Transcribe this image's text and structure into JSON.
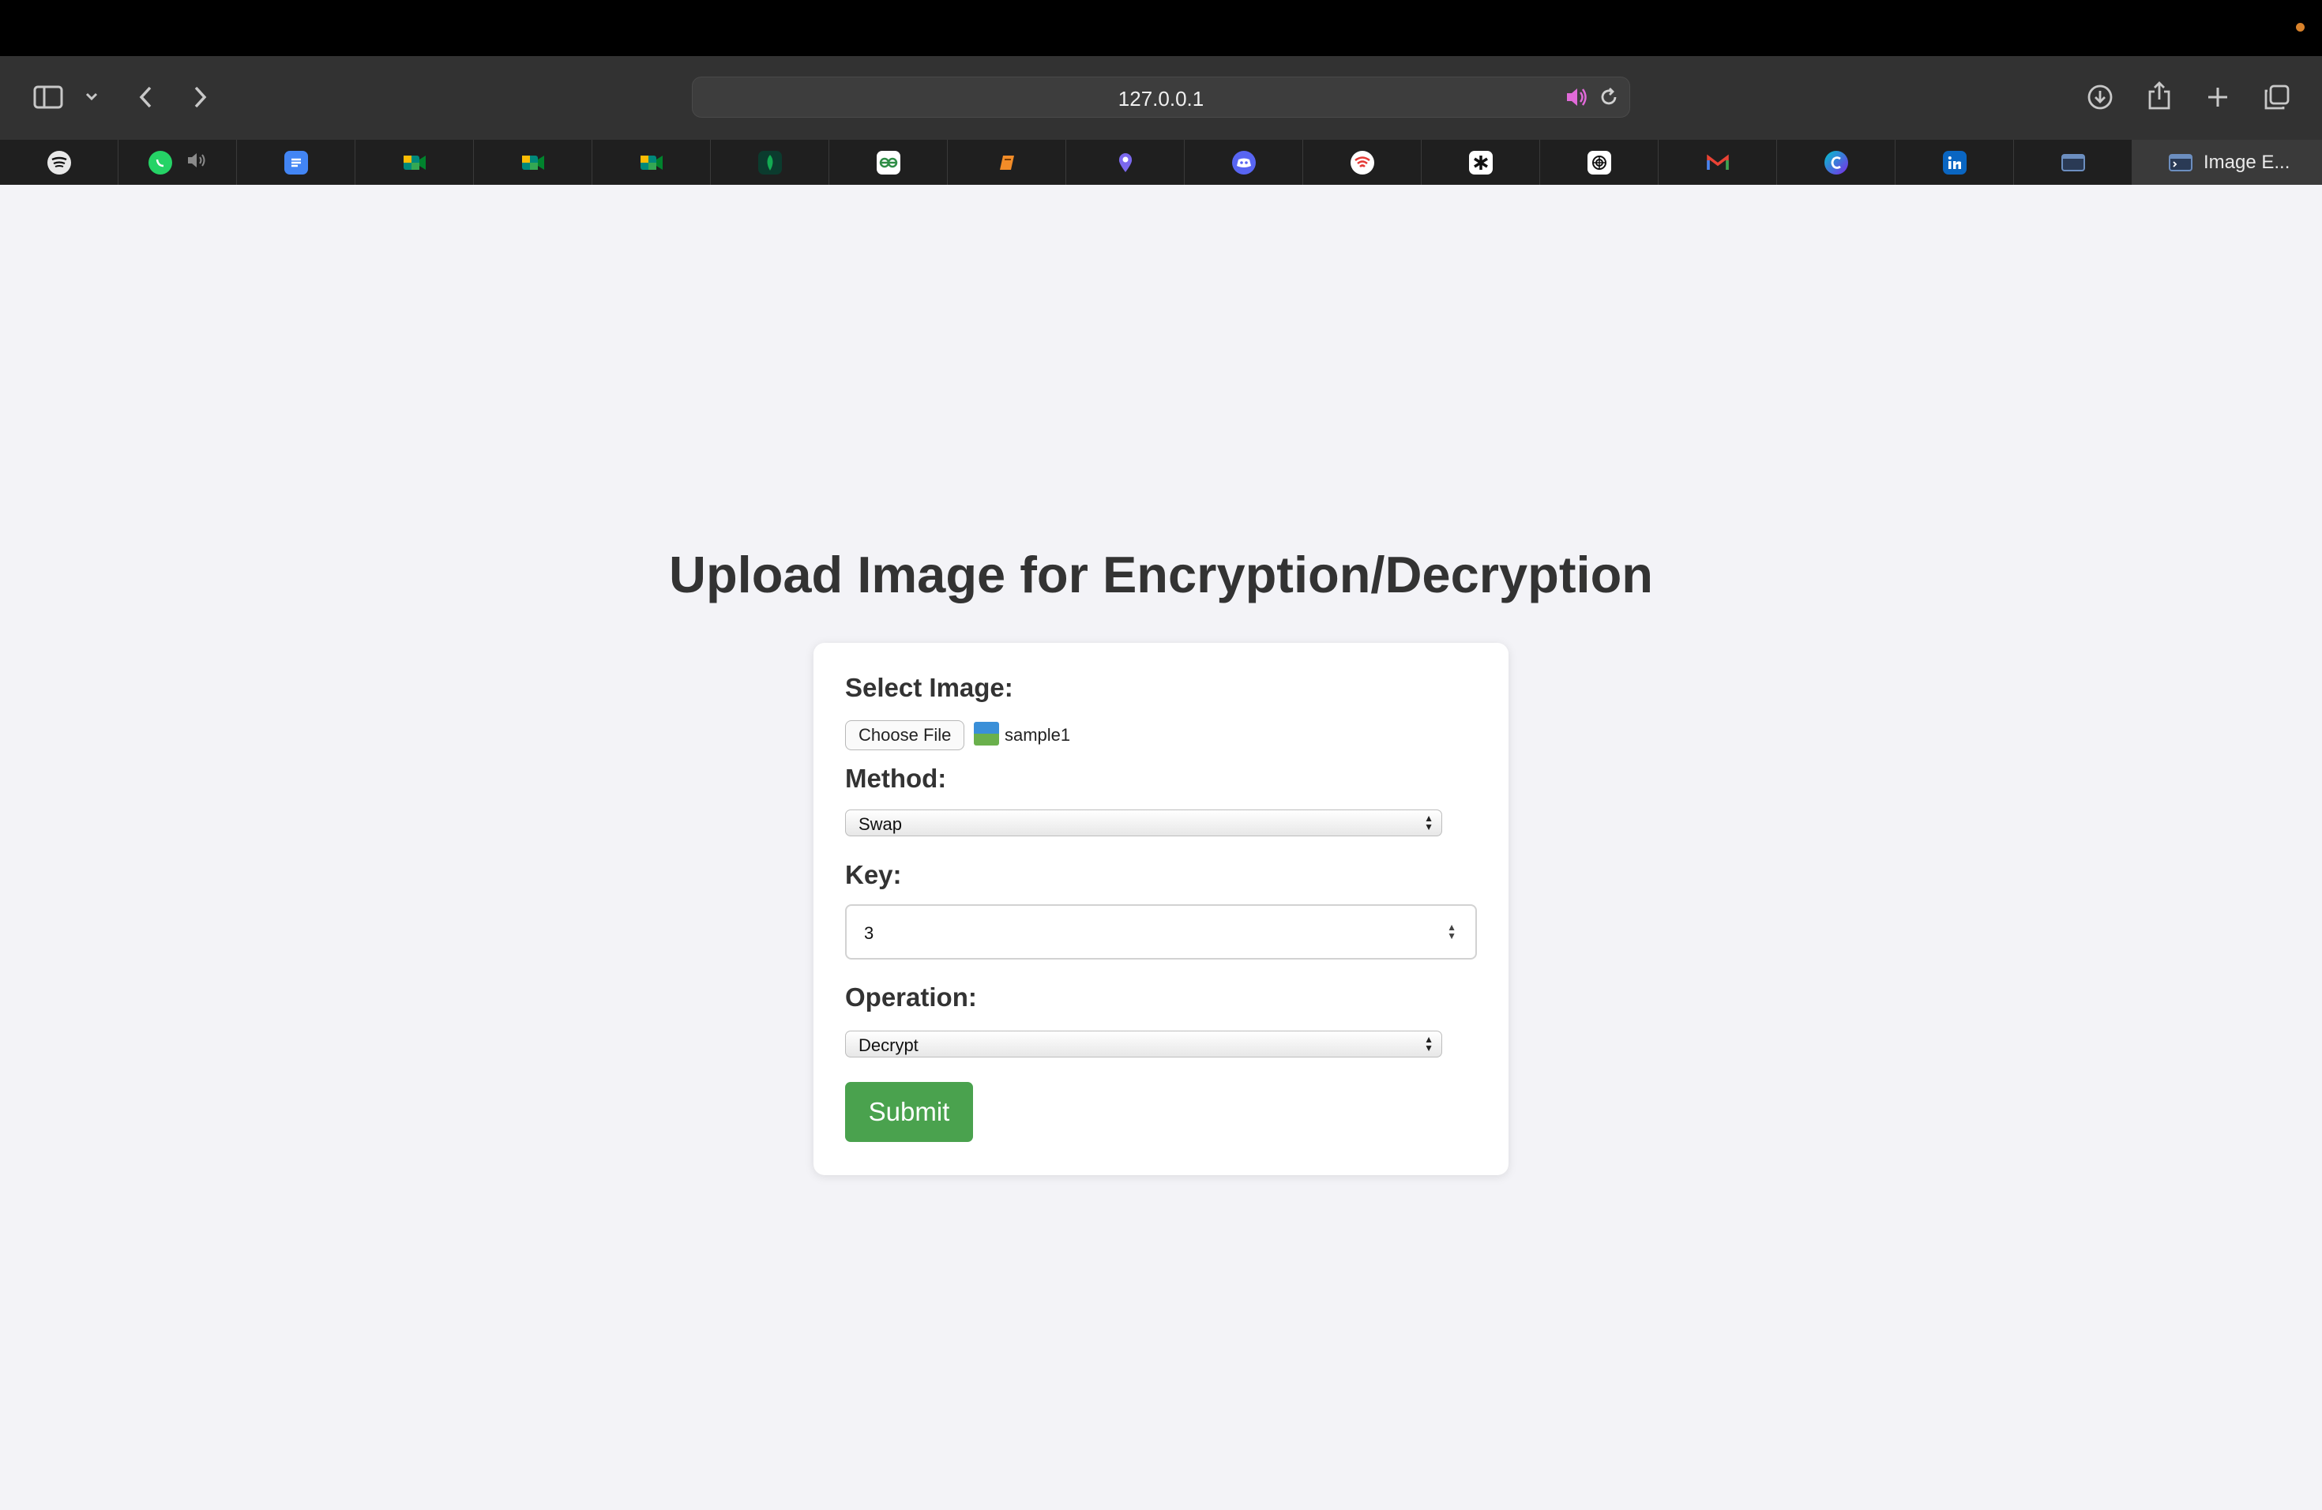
{
  "browser": {
    "url": "127.0.0.1",
    "active_tab_title": "Image E..."
  },
  "page": {
    "title": "Upload Image for Encryption/Decryption",
    "select_image_label": "Select Image:",
    "choose_file_label": "Choose File",
    "file_name": "sample1",
    "method_label": "Method:",
    "method_value": "Swap",
    "key_label": "Key:",
    "key_value": "3",
    "operation_label": "Operation:",
    "operation_value": "Decrypt",
    "submit_label": "Submit"
  },
  "colors": {
    "submit_button": "#4aa24e",
    "page_background": "#f3f3f7",
    "audio_icon": "#e06ad8"
  }
}
